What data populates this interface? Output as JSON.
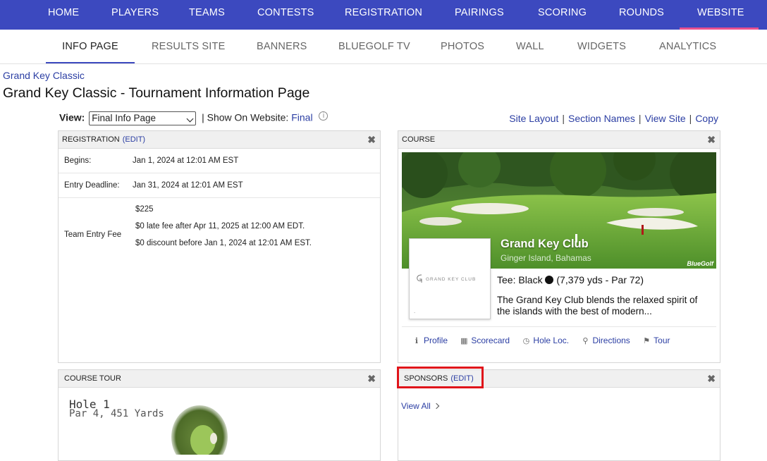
{
  "top_nav": {
    "items": [
      {
        "label": "HOME"
      },
      {
        "label": "PLAYERS"
      },
      {
        "label": "TEAMS"
      },
      {
        "label": "CONTESTS"
      },
      {
        "label": "REGISTRATION"
      },
      {
        "label": "PAIRINGS"
      },
      {
        "label": "SCORING"
      },
      {
        "label": "ROUNDS"
      },
      {
        "label": "WEBSITE"
      }
    ],
    "active": "WEBSITE",
    "bg_color": "#3c49bf",
    "active_underline_color": "#e8508f"
  },
  "sub_nav": {
    "items": [
      {
        "label": "INFO PAGE"
      },
      {
        "label": "RESULTS SITE"
      },
      {
        "label": "BANNERS"
      },
      {
        "label": "BLUEGOLF TV"
      },
      {
        "label": "PHOTOS"
      },
      {
        "label": "WALL"
      },
      {
        "label": "WIDGETS"
      },
      {
        "label": "ANALYTICS"
      }
    ],
    "active": "INFO PAGE"
  },
  "breadcrumb": "Grand Key Classic",
  "page_title": "Grand Key Classic - Tournament Information Page",
  "view_bar": {
    "view_label": "View:",
    "view_selected": "Final Info Page",
    "show_label": "| Show On Website:",
    "show_value": "Final",
    "info_icon": "info-icon"
  },
  "top_links": [
    "Site Layout",
    "Section Names",
    "View Site",
    "Copy"
  ],
  "registration": {
    "title": "REGISTRATION",
    "edit": "(EDIT)",
    "begins_label": "Begins:",
    "begins_value": "Jan 1, 2024 at 12:01 AM EST",
    "deadline_label": "Entry Deadline:",
    "deadline_value": "Jan 31, 2024 at 12:01 AM EST",
    "fee_label": "Team Entry Fee",
    "fee_lines": [
      "$225",
      "$0 late fee after Apr 11, 2025 at 12:00 AM EDT.",
      "$0 discount before Jan 1, 2024 at 12:01 AM EST."
    ]
  },
  "course": {
    "title": "COURSE",
    "name": "Grand Key Club",
    "location": "Ginger Island, Bahamas",
    "watermark": "BlueGolf",
    "logo_text": "GRAND KEY CLUB",
    "logo_dot": ".",
    "tee_label": "Tee: Black",
    "tee_stats": "(7,379 yds - Par 72)",
    "description": "The Grand Key Club blends the relaxed spirit of the islands with the best of modern...",
    "links": [
      {
        "label": "Profile",
        "icon": "info-icon"
      },
      {
        "label": "Scorecard",
        "icon": "table-icon"
      },
      {
        "label": "Hole Loc.",
        "icon": "clock-icon"
      },
      {
        "label": "Directions",
        "icon": "map-pin-icon"
      },
      {
        "label": "Tour",
        "icon": "flag-icon"
      }
    ]
  },
  "course_tour": {
    "title": "COURSE TOUR",
    "hole": "Hole 1",
    "par_yards": "Par 4, 451 Yards"
  },
  "sponsors": {
    "title": "SPONSORS",
    "edit": "(EDIT)",
    "view_all": "View All",
    "highlight_color": "#e0141a"
  },
  "close_glyph": "✖"
}
